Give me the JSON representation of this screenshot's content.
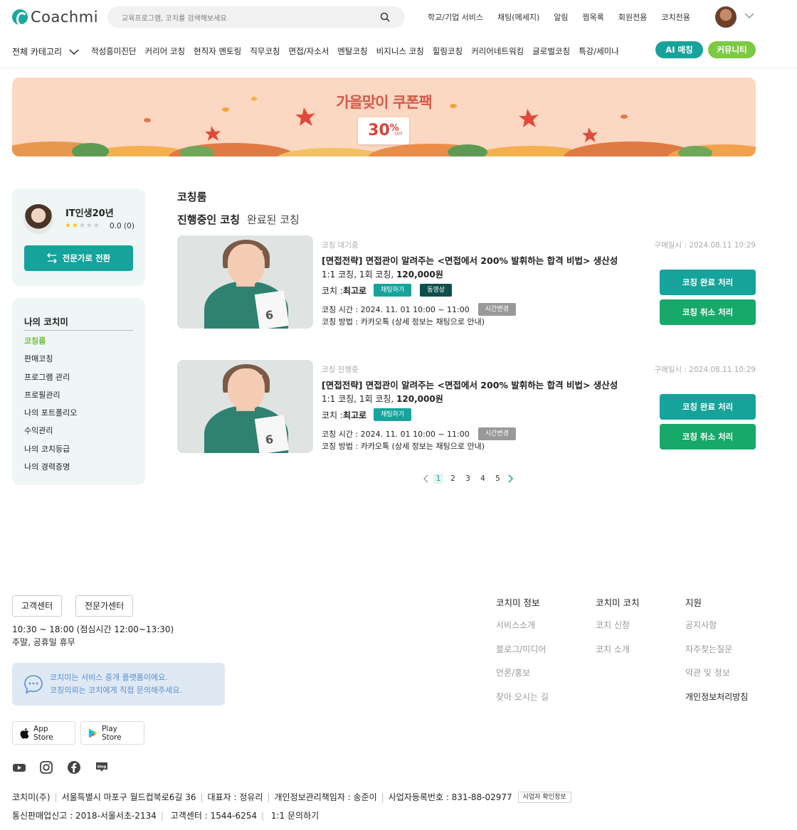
{
  "header": {
    "logo_text": "Coachmi",
    "search_placeholder": "교육프로그램, 코치를 검색해보세요",
    "nav": [
      "학교/기업 서비스",
      "채팅(메세지)",
      "알림",
      "찜목록",
      "회원전용",
      "코치전용"
    ]
  },
  "categories": {
    "all_label": "전체 카테고리",
    "items": [
      "적성흥미진단",
      "커리어 코칭",
      "현직자 멘토링",
      "직무코칭",
      "면접/자소서",
      "멘탈코칭",
      "비지니스 코칭",
      "힐링코칭",
      "커리어네트워킹",
      "글로벌코칭",
      "특강/세미나"
    ],
    "ai_label": "AI 매칭",
    "community_label": "커뮤니티"
  },
  "banner": {
    "title": "가을맞이 쿠폰팩",
    "coupon_value": "30",
    "coupon_unit": "%",
    "coupon_off": "OFF"
  },
  "profile": {
    "name": "IT인생20년",
    "rating": "0.0 (0)",
    "stars_filled": 2,
    "stars_total": 5,
    "switch_label": "전문가로 전환"
  },
  "menu": {
    "title": "나의 코치미",
    "items": [
      "코칭룸",
      "판매코칭",
      "프로그램 관리",
      "프로필관리",
      "나의 포트폴리오",
      "수익관리",
      "나의 코치등급",
      "나의 경력증명"
    ],
    "active_index": 0
  },
  "main": {
    "heading": "코칭룸",
    "tab_active": "진행중인 코칭",
    "tab_inactive": "완료된 코칭",
    "items": [
      {
        "status": "코칭 대기중",
        "title": "[면접전략] 면접관이 알려주는 <면접에서 200% 발휘하는 합격 비법> 생산성",
        "price_prefix": "1:1 코칭, 1회 코칭, ",
        "price": "120,000원",
        "coach_label": "코치 : ",
        "coach_name": "최고로",
        "chat_tag": "채팅하기",
        "video_tag": "동영상",
        "time": "코칭 시간 : 2024. 11. 01 10:00 ~ 11:00",
        "change_tag": "시간변경",
        "method": "코칭 방법 : 카카오톡 (상세 정보는 채팅으로 안내)",
        "purchase": "구매일시 : 2024.08.11 10:29",
        "done_btn": "코칭 완료 처리",
        "cancel_btn": "코칭 취소 처리",
        "book_number": "6"
      },
      {
        "status": "코칭 진행중",
        "title": "[면접전략] 면접관이 알려주는 <면접에서 200% 발휘하는 합격 비법> 생산성",
        "price_prefix": "1:1 코칭, 1회 코칭, ",
        "price": "120,000원",
        "coach_label": "코치 : ",
        "coach_name": "최고로",
        "chat_tag": "채팅하기",
        "time": "코칭 시간 : 2024. 11. 01 10:00 ~ 11:00",
        "change_tag": "시간변경",
        "method": "코칭 방법 : 카카오톡 (상세 정보는 채팅으로 안내)",
        "purchase": "구매일시 : 2024.08.11 10:29",
        "done_btn": "코칭 완료 처리",
        "cancel_btn": "코칭 취소 처리",
        "book_number": "6"
      }
    ],
    "pagination": [
      "1",
      "2",
      "3",
      "4",
      "5"
    ],
    "current_page": "1"
  },
  "footer": {
    "customer_center": "고객센터",
    "expert_center": "전문가센터",
    "hours": "10:30 ~ 18:00 (점심시간 12:00~13:30)",
    "holiday": "주말, 공휴일 휴무",
    "notice_line1": "코치미는 서비스 중개 플랫폼이에요.",
    "notice_line2": "코칭의뢰는 코치에게 직접 문의해주세요.",
    "app_store": "App Store",
    "play_store": "Play Store",
    "col1_title": "코치미 정보",
    "col1": [
      "서비스소개",
      "블로그/미디어",
      "언론/홍보",
      "찾아 오시는 길"
    ],
    "col2_title": "코치미 코치",
    "col2": [
      "코치 신청",
      "코치 소개"
    ],
    "col3_title": "지원",
    "col3": [
      "공지사항",
      "자주찾는질문",
      "약관 및 정보",
      "개인정보처리방침"
    ],
    "company": "코치미(주)",
    "address": "서울특별시 마포구 월드컵북로6길 36",
    "ceo": "대표자 : 정유리",
    "privacy_officer": "개인정보관리책임자 : 송준이",
    "biz_no": "사업자등록번호 : 831-88-02977",
    "biz_check": "사업자 확인정보",
    "mail_order": "통신판매업신고 : 2018-서울서초-2134",
    "phone": "고객센터 : 1544-6254",
    "inquiry": "1:1 문의하기"
  }
}
